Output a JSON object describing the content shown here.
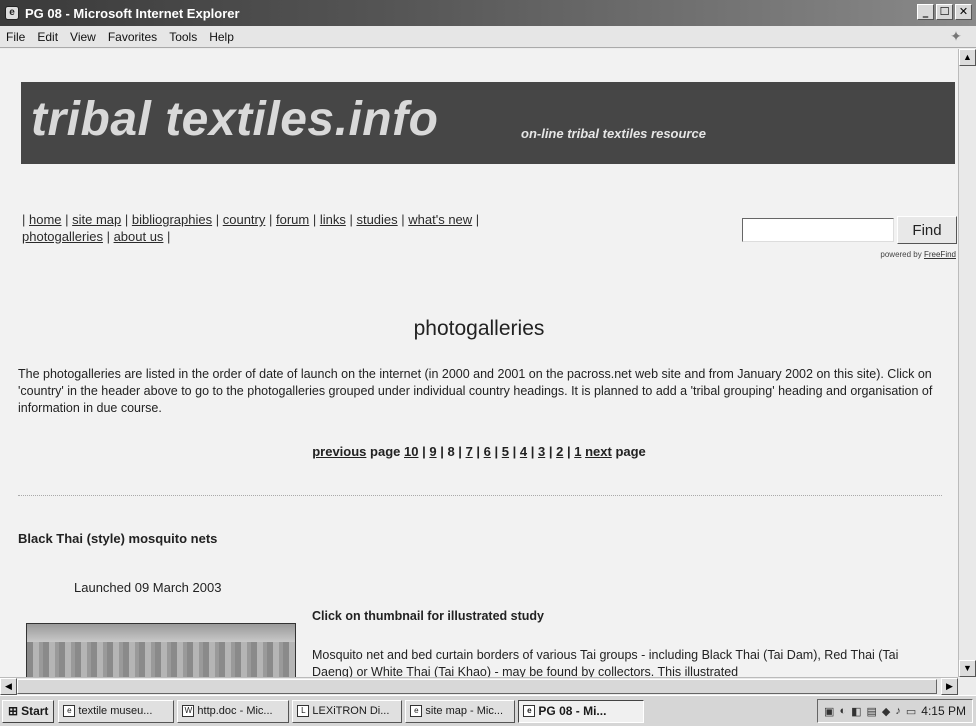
{
  "window": {
    "title": "PG 08 - Microsoft Internet Explorer",
    "app_icon": "ie-icon",
    "minimize": "_",
    "maximize": "☐",
    "close": "✕"
  },
  "menu": [
    "File",
    "Edit",
    "View",
    "Favorites",
    "Tools",
    "Help"
  ],
  "site": {
    "logo": "tribal textiles.info",
    "tagline": "on-line tribal textiles resource"
  },
  "nav": {
    "items": [
      "home",
      "site map",
      "bibliographies",
      "country",
      "forum",
      "links",
      "studies",
      "what's new",
      "photogalleries",
      "about us"
    ]
  },
  "search": {
    "value": "",
    "button": "Find",
    "powered_prefix": "powered by",
    "powered_link": "FreeFind"
  },
  "page": {
    "title": "photogalleries",
    "intro": "The photogalleries are listed in the order of date of launch on the internet (in 2000 and 2001 on the pacross.net web site and from January 2002 on this site). Click on 'country' in the header above to go to the photogalleries grouped under individual country headings. It is planned to add a 'tribal grouping' heading and organisation of information in due course.",
    "pager": {
      "previous": "previous",
      "page_word": "page",
      "pages": [
        "10",
        "9",
        "8",
        "7",
        "6",
        "5",
        "4",
        "3",
        "2",
        "1"
      ],
      "current": "8",
      "next": "next",
      "trailing": "page"
    }
  },
  "gallery": {
    "title": "Black Thai (style) mosquito nets",
    "launched": "Launched 09 March 2003",
    "click_note": "Click on thumbnail for illustrated study",
    "description": "Mosquito net and bed curtain borders of various Tai groups - including Black Thai (Tai Dam), Red Thai (Tai Daeng) or White Thai (Tai Khao) - may be found by collectors. This illustrated"
  },
  "taskbar": {
    "start": "Start",
    "tasks": [
      {
        "label": "textile museu...",
        "icon": "ie-icon",
        "active": false
      },
      {
        "label": "http.doc - Mic...",
        "icon": "word-icon",
        "active": false
      },
      {
        "label": "LEXiTRON Di...",
        "icon": "app-icon",
        "active": false
      },
      {
        "label": "site map - Mic...",
        "icon": "ie-icon",
        "active": false
      },
      {
        "label": "PG 08 - Mi...",
        "icon": "ie-icon",
        "active": true
      }
    ],
    "clock": "4:15 PM"
  }
}
